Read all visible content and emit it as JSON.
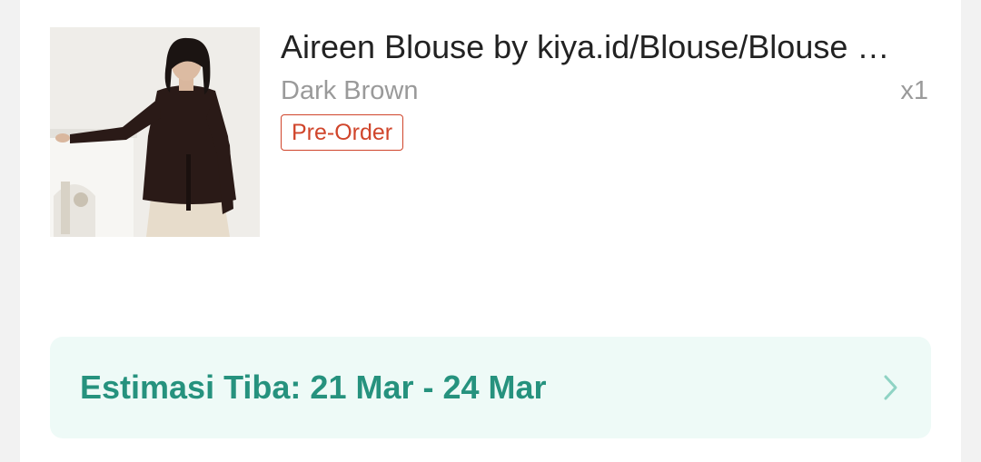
{
  "product": {
    "title": "Aireen Blouse by kiya.id/Blouse/Blouse Wanita",
    "variant": "Dark Brown",
    "quantity": "x1",
    "badge": "Pre-Order",
    "image_icon": "product-photo"
  },
  "estimate": {
    "label": "Estimasi Tiba: 21 Mar - 24 Mar",
    "icon": "chevron-right-icon"
  },
  "colors": {
    "badge": "#d0452b",
    "eta_text": "#26927e",
    "eta_background": "#eefaf7"
  }
}
